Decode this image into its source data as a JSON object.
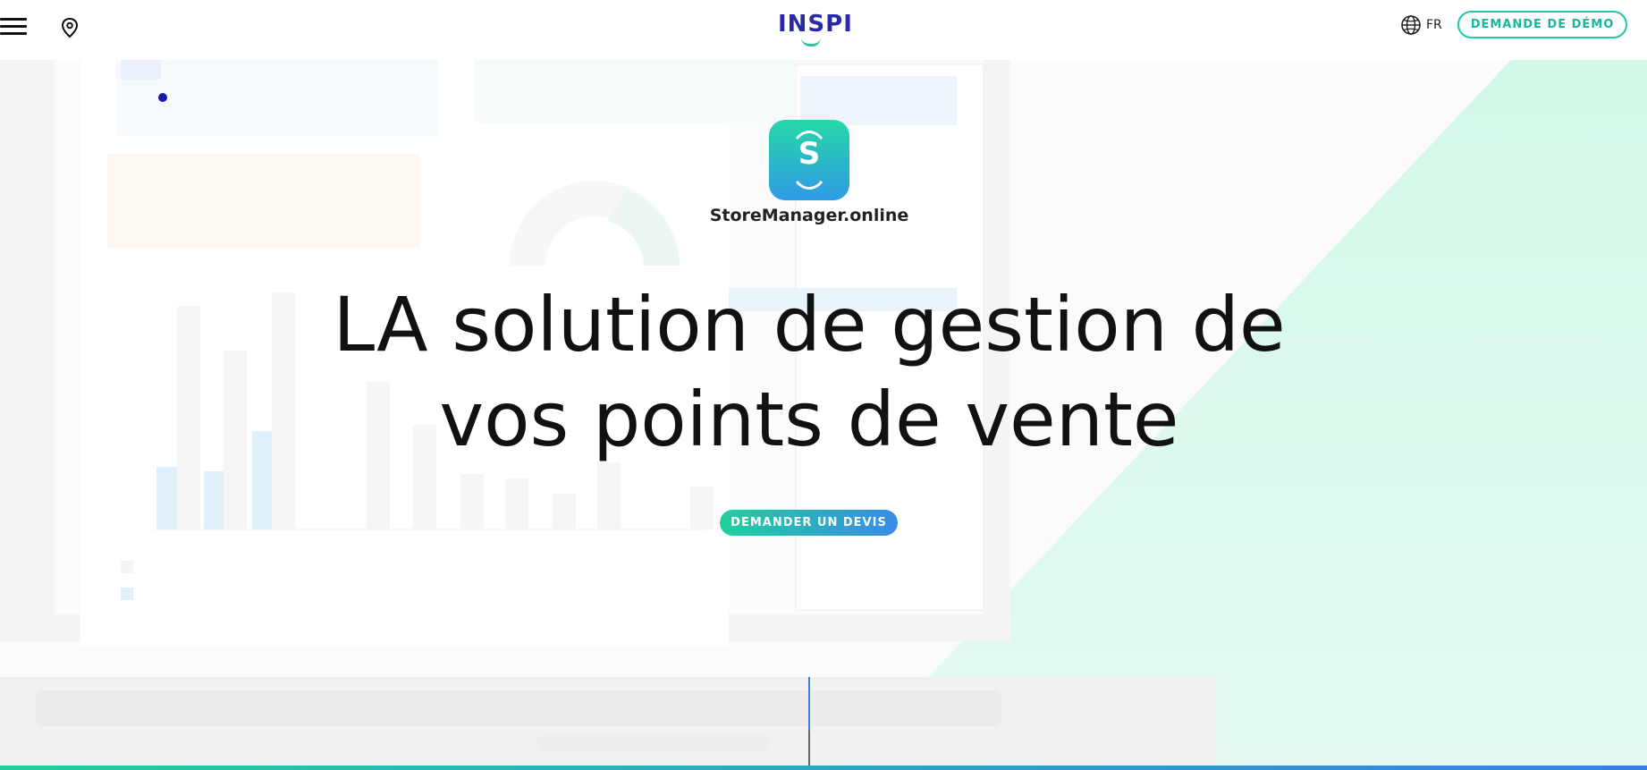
{
  "header": {
    "menu_icon": "hamburger-menu-icon",
    "location_icon": "map-pin-icon",
    "logo_text": "INSPI",
    "language_icon": "globe-icon",
    "language_label": "FR",
    "demo_button_label": "DEMANDE DE DÉMO"
  },
  "hero": {
    "app_icon": "storemanager-app-icon",
    "app_icon_letter": "S",
    "app_name": "StoreManager.online",
    "headline": "LA solution de gestion de vos points de vente",
    "quote_button_label": "DEMANDER UN DEVIS"
  },
  "colors": {
    "brand_blue": "#2a2aa8",
    "brand_green": "#1ec9a8",
    "gradient_start": "#20d09c",
    "gradient_end": "#3a8be6",
    "hero_green_bg": "#b8f0d6"
  }
}
